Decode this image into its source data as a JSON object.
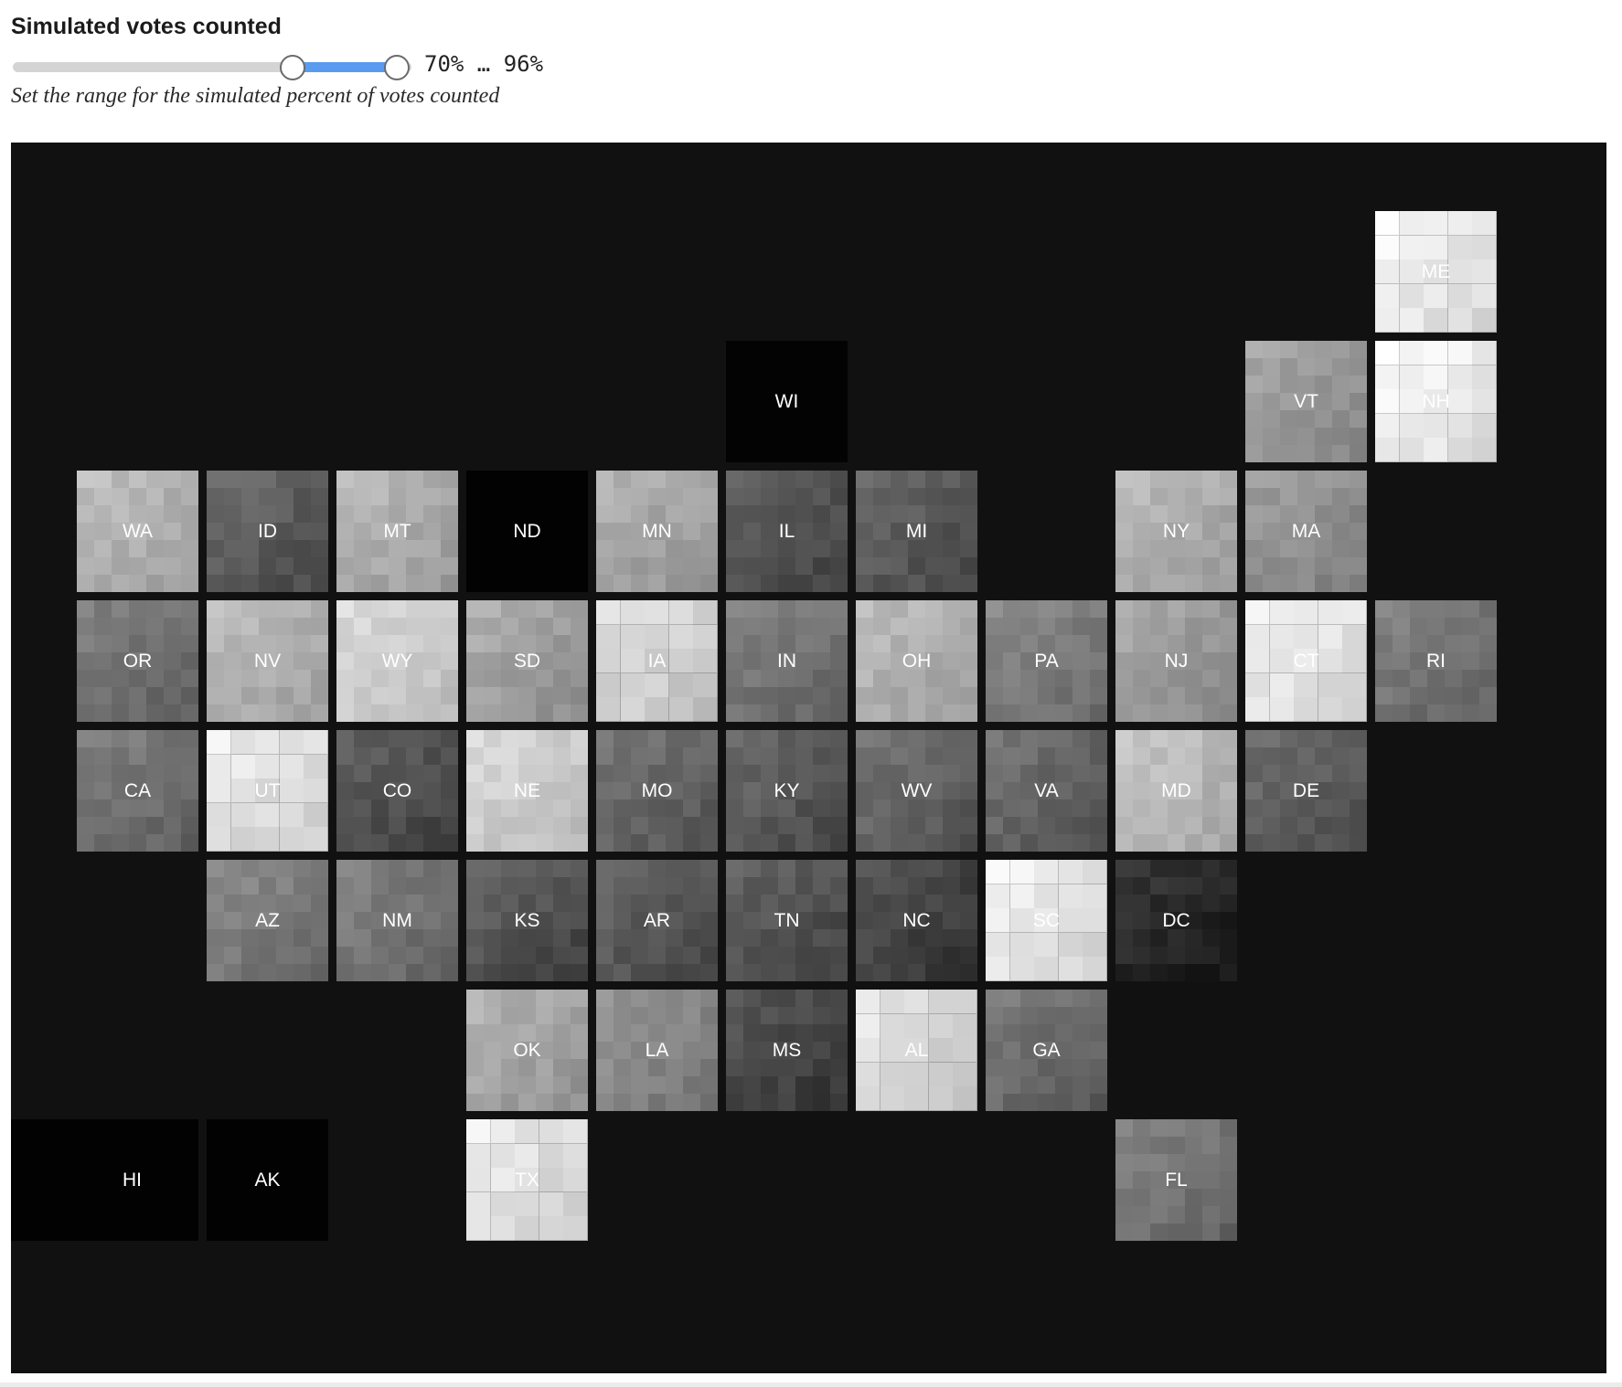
{
  "control": {
    "title": "Simulated votes counted",
    "range": {
      "min": 0,
      "max": 100,
      "low": 70,
      "high": 96
    },
    "readout": "70% … 96%",
    "caption": "Set the range for the simulated percent of votes counted",
    "accent_color": "#5a9bf0"
  },
  "map": {
    "background": "#111111",
    "states": [
      {
        "id": "ME",
        "col": 10,
        "row": 0,
        "gray": 228
      },
      {
        "id": "WI",
        "col": 5,
        "row": 1,
        "gray": 3
      },
      {
        "id": "VT",
        "col": 9,
        "row": 1,
        "gray": 148
      },
      {
        "id": "NH",
        "col": 10,
        "row": 1,
        "gray": 232
      },
      {
        "id": "WA",
        "col": 0,
        "row": 2,
        "gray": 172
      },
      {
        "id": "ID",
        "col": 1,
        "row": 2,
        "gray": 88
      },
      {
        "id": "MT",
        "col": 2,
        "row": 2,
        "gray": 168
      },
      {
        "id": "ND",
        "col": 3,
        "row": 2,
        "gray": 2
      },
      {
        "id": "MN",
        "col": 4,
        "row": 2,
        "gray": 160
      },
      {
        "id": "IL",
        "col": 5,
        "row": 2,
        "gray": 80
      },
      {
        "id": "MI",
        "col": 6,
        "row": 2,
        "gray": 86
      },
      {
        "id": "NY",
        "col": 8,
        "row": 2,
        "gray": 168
      },
      {
        "id": "MA",
        "col": 9,
        "row": 2,
        "gray": 140
      },
      {
        "id": "OR",
        "col": 0,
        "row": 3,
        "gray": 110
      },
      {
        "id": "NV",
        "col": 1,
        "row": 3,
        "gray": 172
      },
      {
        "id": "WY",
        "col": 2,
        "row": 3,
        "gray": 200
      },
      {
        "id": "SD",
        "col": 3,
        "row": 3,
        "gray": 155
      },
      {
        "id": "IA",
        "col": 4,
        "row": 3,
        "gray": 205
      },
      {
        "id": "IN",
        "col": 5,
        "row": 3,
        "gray": 112
      },
      {
        "id": "OH",
        "col": 6,
        "row": 3,
        "gray": 170
      },
      {
        "id": "PA",
        "col": 7,
        "row": 3,
        "gray": 120
      },
      {
        "id": "NJ",
        "col": 8,
        "row": 3,
        "gray": 150
      },
      {
        "id": "CT",
        "col": 9,
        "row": 3,
        "gray": 222
      },
      {
        "id": "RI",
        "col": 10,
        "row": 3,
        "gray": 112
      },
      {
        "id": "CA",
        "col": 0,
        "row": 4,
        "gray": 110
      },
      {
        "id": "UT",
        "col": 1,
        "row": 4,
        "gray": 218
      },
      {
        "id": "CO",
        "col": 2,
        "row": 4,
        "gray": 78
      },
      {
        "id": "NE",
        "col": 3,
        "row": 4,
        "gray": 200
      },
      {
        "id": "MO",
        "col": 4,
        "row": 4,
        "gray": 98
      },
      {
        "id": "KY",
        "col": 5,
        "row": 4,
        "gray": 86
      },
      {
        "id": "WV",
        "col": 6,
        "row": 4,
        "gray": 96
      },
      {
        "id": "VA",
        "col": 7,
        "row": 4,
        "gray": 96
      },
      {
        "id": "MD",
        "col": 8,
        "row": 4,
        "gray": 180
      },
      {
        "id": "DE",
        "col": 9,
        "row": 4,
        "gray": 90
      },
      {
        "id": "AZ",
        "col": 1,
        "row": 5,
        "gray": 120
      },
      {
        "id": "NM",
        "col": 2,
        "row": 5,
        "gray": 112
      },
      {
        "id": "KS",
        "col": 3,
        "row": 5,
        "gray": 80
      },
      {
        "id": "AR",
        "col": 4,
        "row": 5,
        "gray": 84
      },
      {
        "id": "TN",
        "col": 5,
        "row": 5,
        "gray": 80
      },
      {
        "id": "NC",
        "col": 6,
        "row": 5,
        "gray": 64
      },
      {
        "id": "SC",
        "col": 7,
        "row": 5,
        "gray": 222
      },
      {
        "id": "DC",
        "col": 8,
        "row": 5,
        "gray": 36
      },
      {
        "id": "OK",
        "col": 3,
        "row": 6,
        "gray": 160
      },
      {
        "id": "LA",
        "col": 4,
        "row": 6,
        "gray": 130
      },
      {
        "id": "MS",
        "col": 5,
        "row": 6,
        "gray": 66
      },
      {
        "id": "AL",
        "col": 6,
        "row": 6,
        "gray": 212
      },
      {
        "id": "GA",
        "col": 7,
        "row": 6,
        "gray": 104
      },
      {
        "id": "HI",
        "col": 0,
        "row": 7,
        "gray": 2
      },
      {
        "id": "AK",
        "col": 1,
        "row": 7,
        "gray": 2
      },
      {
        "id": "TX",
        "col": 3,
        "row": 7,
        "gray": 218
      },
      {
        "id": "FL",
        "col": 8,
        "row": 7,
        "gray": 112
      }
    ]
  }
}
